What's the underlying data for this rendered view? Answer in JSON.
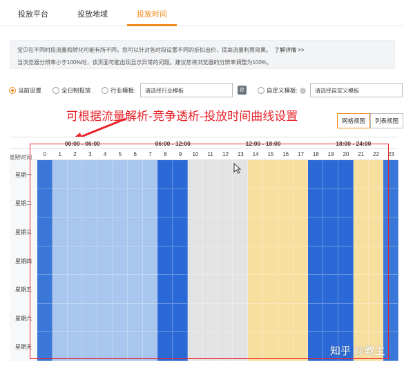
{
  "tabs": [
    {
      "label": "投放平台",
      "active": false
    },
    {
      "label": "投放地域",
      "active": false
    },
    {
      "label": "投放时间",
      "active": true
    }
  ],
  "notice": {
    "line1": "宝贝在不同时段流量和转化可能有所不同，您可以针对各时段设置不同的折扣出价，提高流量利用效果。",
    "link": "了解详情 >>",
    "line2": "当浏览器分辨率小于100%时，该页面可能出现显示异常的问题。建议您将浏览器的分辨率调整为100%。"
  },
  "options": {
    "current": "当前设置",
    "all_day": "全日制投放",
    "industry": "行业模板:",
    "industry_placeholder": "请选择行业模板",
    "save_icon": "存",
    "custom": "自定义模板:",
    "custom_placeholder": "请选择自定义模板"
  },
  "annotation": "可根据流量解析-竞争透析-投放时间曲线设置",
  "view_toggle": {
    "grid": "网格视图",
    "list": "列表视图"
  },
  "grid": {
    "corner": "星期\\时间",
    "ranges": [
      "00:00 - 06:00",
      "06:00 - 12:00",
      "12:00 - 18:00",
      "18:00 - 24:00"
    ],
    "hours": [
      "0",
      "1",
      "2",
      "3",
      "4",
      "5",
      "6",
      "7",
      "8",
      "9",
      "10",
      "11",
      "12",
      "13",
      "14",
      "15",
      "16",
      "17",
      "18",
      "19",
      "20",
      "21",
      "22",
      "23"
    ],
    "days": [
      "星期一",
      "星期二",
      "星期三",
      "星期四",
      "星期五",
      "星期六",
      "星期天"
    ],
    "hour_colors": [
      "#3b77d8",
      "#a9c6ef",
      "#a9c6ef",
      "#a9c6ef",
      "#a9c6ef",
      "#a9c6ef",
      "#a9c6ef",
      "#a9c6ef",
      "#2b6ad6",
      "#2b6ad6",
      "#e3e3e3",
      "#e3e3e3",
      "#e3e3e3",
      "#e3e3e3",
      "#f7dfa0",
      "#f7dfa0",
      "#f7dfa0",
      "#f7dfa0",
      "#2b6ad6",
      "#2b6ad6",
      "#2b6ad6",
      "#f7dfa0",
      "#f7dfa0",
      "#3b77d8"
    ]
  },
  "watermark": "知乎 @教主"
}
